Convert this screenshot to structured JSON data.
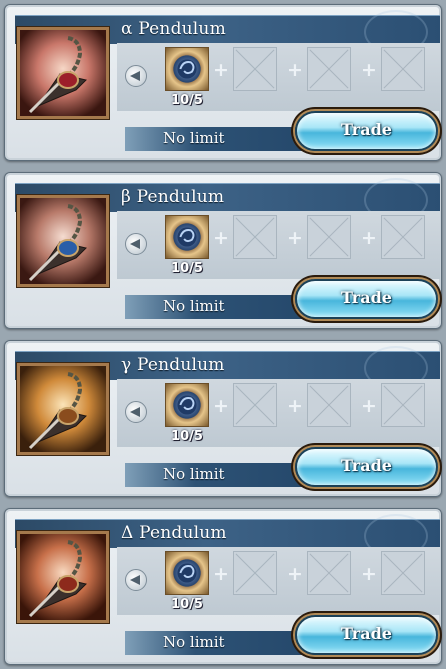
{
  "rows": [
    {
      "title": "α Pendulum",
      "material_count": "10/5",
      "limit_text": "No limit",
      "trade_label": "Trade",
      "icon": "alpha-pendulum-icon",
      "gem_color": "#9c1f2a"
    },
    {
      "title": "β Pendulum",
      "material_count": "10/5",
      "limit_text": "No limit",
      "trade_label": "Trade",
      "icon": "beta-pendulum-icon",
      "gem_color": "#2a5ea8"
    },
    {
      "title": "γ Pendulum",
      "material_count": "10/5",
      "limit_text": "No limit",
      "trade_label": "Trade",
      "icon": "gamma-pendulum-icon",
      "gem_color": "#8a4c1d"
    },
    {
      "title": "Δ Pendulum",
      "material_count": "10/5",
      "limit_text": "No limit",
      "trade_label": "Trade",
      "icon": "delta-pendulum-icon",
      "gem_color": "#8d2a1c"
    }
  ],
  "material": {
    "icon": "blue-orb-material-icon"
  },
  "colors": {
    "title_bar": "#2c4a66",
    "trade_button": "#48b6dc",
    "frame_gold": "#a5794c"
  }
}
